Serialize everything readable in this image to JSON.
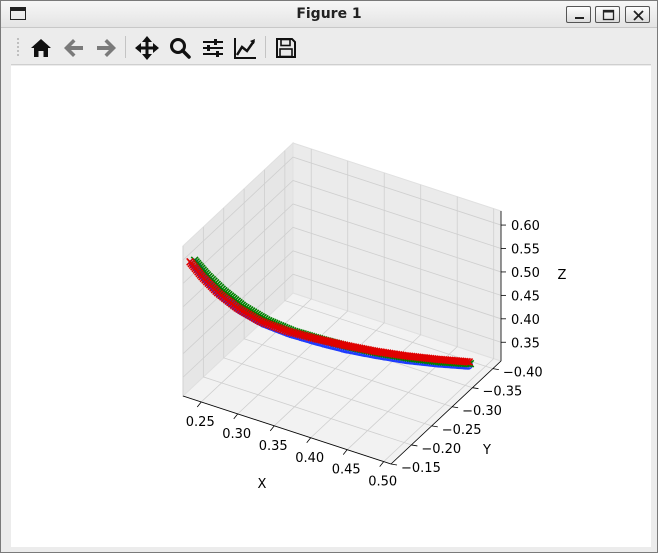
{
  "window": {
    "title": "Figure 1",
    "icons": {
      "app": "window-icon",
      "minimize": "minimize-icon",
      "maximize": "maximize-icon",
      "close": "close-icon"
    }
  },
  "toolbar": {
    "buttons": [
      {
        "name": "home",
        "icon": "home-icon"
      },
      {
        "name": "back",
        "icon": "arrow-left-icon"
      },
      {
        "name": "forward",
        "icon": "arrow-right-icon"
      },
      {
        "name": "pan",
        "icon": "move-icon"
      },
      {
        "name": "zoom",
        "icon": "magnifier-icon"
      },
      {
        "name": "configure-subplots",
        "icon": "sliders-icon"
      },
      {
        "name": "edit-axes",
        "icon": "line-chart-icon"
      },
      {
        "name": "save",
        "icon": "floppy-icon"
      }
    ]
  },
  "chart_data": {
    "type": "scatter",
    "projection": "3d",
    "xlabel": "X",
    "ylabel": "Y",
    "zlabel": "Z",
    "x_ticks": [
      "0.25",
      "0.30",
      "0.35",
      "0.40",
      "0.45",
      "0.50"
    ],
    "y_ticks": [
      "−0.15",
      "−0.20",
      "−0.25",
      "−0.30",
      "−0.35",
      "−0.40"
    ],
    "z_ticks": [
      "0.35",
      "0.40",
      "0.45",
      "0.50",
      "0.55",
      "0.60"
    ],
    "xlim": [
      0.225,
      0.51
    ],
    "ylim": [
      -0.15,
      -0.42
    ],
    "zlim": [
      0.31,
      0.63
    ],
    "grid": true,
    "series": [
      {
        "color": "#1f3cff",
        "marker": "o",
        "points": [
          [
            0.232,
            -0.164,
            0.585
          ],
          [
            0.245,
            -0.17,
            0.555
          ],
          [
            0.262,
            -0.178,
            0.522
          ],
          [
            0.282,
            -0.19,
            0.49
          ],
          [
            0.305,
            -0.205,
            0.462
          ],
          [
            0.33,
            -0.222,
            0.44
          ],
          [
            0.358,
            -0.242,
            0.42
          ],
          [
            0.385,
            -0.262,
            0.402
          ],
          [
            0.412,
            -0.285,
            0.385
          ],
          [
            0.44,
            -0.31,
            0.368
          ],
          [
            0.468,
            -0.338,
            0.352
          ],
          [
            0.495,
            -0.366,
            0.338
          ]
        ]
      },
      {
        "color": "#008000",
        "marker": "x",
        "points": [
          [
            0.232,
            -0.166,
            0.59
          ],
          [
            0.246,
            -0.172,
            0.561
          ],
          [
            0.264,
            -0.18,
            0.53
          ],
          [
            0.285,
            -0.192,
            0.497
          ],
          [
            0.308,
            -0.207,
            0.468
          ],
          [
            0.334,
            -0.224,
            0.444
          ],
          [
            0.362,
            -0.245,
            0.423
          ],
          [
            0.39,
            -0.266,
            0.404
          ],
          [
            0.417,
            -0.289,
            0.386
          ],
          [
            0.445,
            -0.314,
            0.369
          ],
          [
            0.472,
            -0.341,
            0.353
          ],
          [
            0.497,
            -0.368,
            0.34
          ]
        ]
      },
      {
        "color": "#e00000",
        "marker": "x",
        "points": [
          [
            0.228,
            -0.162,
            0.588
          ],
          [
            0.241,
            -0.168,
            0.558
          ],
          [
            0.258,
            -0.176,
            0.526
          ],
          [
            0.278,
            -0.188,
            0.494
          ],
          [
            0.301,
            -0.203,
            0.465
          ],
          [
            0.328,
            -0.221,
            0.443
          ],
          [
            0.356,
            -0.241,
            0.425
          ],
          [
            0.384,
            -0.262,
            0.408
          ],
          [
            0.412,
            -0.285,
            0.391
          ],
          [
            0.44,
            -0.31,
            0.375
          ],
          [
            0.468,
            -0.338,
            0.359
          ],
          [
            0.496,
            -0.367,
            0.344
          ]
        ]
      }
    ]
  }
}
